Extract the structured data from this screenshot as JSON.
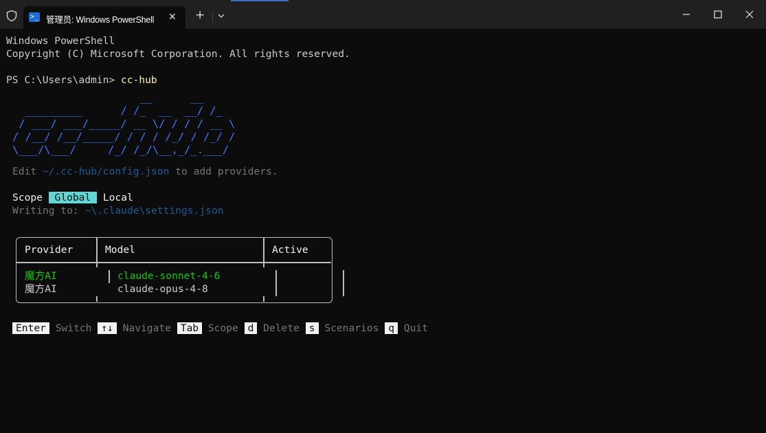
{
  "window": {
    "tab_title": "管理员: Windows PowerShell",
    "tab_icon_glyph": ">_",
    "close_tab_glyph": "✕",
    "new_tab_glyph": "+",
    "minimize_glyph": "—",
    "maximize_glyph": "☐",
    "close_glyph": "✕"
  },
  "terminal": {
    "banner_line1": "Windows PowerShell",
    "banner_line2": "Copyright (C) Microsoft Corporation. All rights reserved.",
    "prompt": "PS C:\\Users\\admin> ",
    "command": "cc-hub",
    "ascii_logo": "                    __      __\n  _________      / /_  __  __/ /_\n / ___/ ___/_____/ __ \\/ / / / __ \\\n/ /__/ /__/_____/ / / / /_/ / /_/ /\n\\___/\\___/     /_/ /_/\\__,_/_.___/",
    "edit_prefix": "Edit ",
    "edit_path": "~/.cc-hub/config.json",
    "edit_suffix": " to add providers.",
    "scope_label": "Scope",
    "scope_global": "Global",
    "scope_local": "Local",
    "writing_label": "Writing to: ",
    "writing_path": "~\\.claude\\settings.json"
  },
  "table": {
    "headers": [
      "Provider",
      "Model",
      "Active"
    ],
    "rows": [
      {
        "provider": "魔方AI",
        "model": "claude-sonnet-4-6",
        "active": "",
        "selected": true
      },
      {
        "provider": "魔方AI",
        "model": "claude-opus-4-8",
        "active": "",
        "selected": false
      }
    ]
  },
  "hints": [
    {
      "key": "Enter",
      "label": "Switch"
    },
    {
      "key": "↑↓",
      "label": "Navigate"
    },
    {
      "key": "Tab",
      "label": "Scope"
    },
    {
      "key": "d",
      "label": "Delete"
    },
    {
      "key": "s",
      "label": "Scenarios"
    },
    {
      "key": "q",
      "label": "Quit"
    }
  ],
  "colors": {
    "background": "#0c0c0c",
    "titlebar": "#202020",
    "logo_blue": "#3b78ff",
    "scope_highlight": "#61d6d6",
    "selected_green": "#16c60c",
    "command_yellow": "#f9f1a5"
  }
}
